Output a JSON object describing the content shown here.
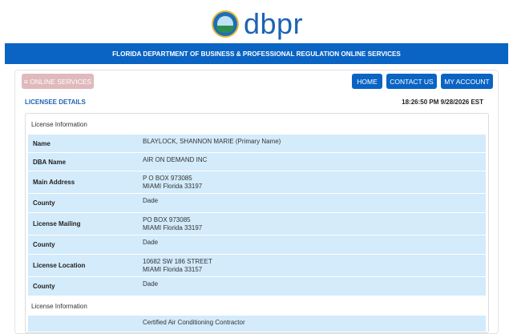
{
  "brand": {
    "name": "dbpr"
  },
  "banner": {
    "text": "FLORIDA DEPARTMENT OF BUSINESS & PROFESSIONAL REGULATION ONLINE SERVICES"
  },
  "nav": {
    "online_services": "≡ ONLINE SERVICES",
    "home": "HOME",
    "contact": "CONTACT US",
    "account": "MY ACCOUNT"
  },
  "section": {
    "title": "LICENSEE DETAILS",
    "timestamp": "18:26:50 PM 9/28/2026 EST"
  },
  "license_info": {
    "header": "License Information",
    "rows": [
      {
        "label": "Name",
        "line1": "BLAYLOCK, SHANNON MARIE (Primary Name)",
        "line2": ""
      },
      {
        "label": "DBA Name",
        "line1": "AIR ON DEMAND INC",
        "line2": ""
      },
      {
        "label": "Main Address",
        "line1": "P O BOX 973085",
        "line2": "MIAMI Florida 33197"
      },
      {
        "label": "County",
        "line1": "Dade",
        "line2": ""
      },
      {
        "label": "License Mailing",
        "line1": "PO BOX 973085",
        "line2": "MIAMI Florida 33197"
      },
      {
        "label": "County",
        "line1": "Dade",
        "line2": ""
      },
      {
        "label": "License Location",
        "line1": "10682 SW 186 STREET",
        "line2": "MIAMI Florida 33157"
      },
      {
        "label": "County",
        "line1": "Dade",
        "line2": ""
      }
    ],
    "header2": "License Information",
    "partial_value": "Certified Air Conditioning Contractor"
  },
  "colors": {
    "brand_blue": "#0a64c4",
    "row_blue": "#d3ebfb",
    "disabled_pink": "#e0b9bd"
  },
  "icons": {
    "logo": "florida-seal-icon",
    "menu": "hamburger-icon"
  }
}
